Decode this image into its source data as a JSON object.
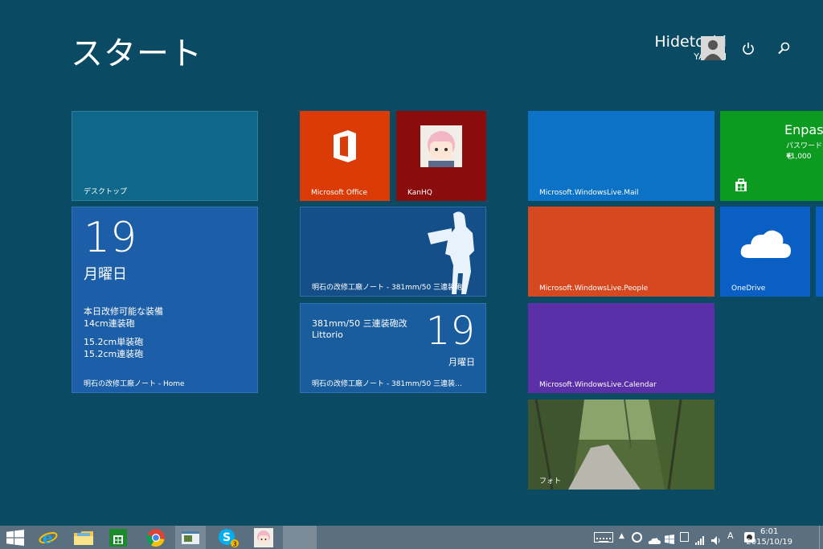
{
  "screen": {
    "title": "スタート"
  },
  "user": {
    "name": "Hidetoshi",
    "subname": "YANAGI"
  },
  "tiles": {
    "desktop": {
      "label": "デスクトップ"
    },
    "calendar_home": {
      "day": "19",
      "weekday": "月曜日",
      "line1": "本日改修可能な装備",
      "line2": "14cm連装砲",
      "line3": "15.2cm単装砲",
      "line4": "15.2cm連装砲",
      "label": "明石の改修工廠ノート - Home"
    },
    "office": {
      "label": "Microsoft Office"
    },
    "kanhq": {
      "label": "KanHQ"
    },
    "blog_a": {
      "label": "明石の改修工廠ノート - 381mm/50 三連装砲"
    },
    "blog_b": {
      "line1": "381mm/50 三連装砲改",
      "line2": "Littorio",
      "day": "19",
      "weekday": "月曜日",
      "label": "明石の改修工廠ノート - 381mm/50 三連装…"
    },
    "mail": {
      "label": "Microsoft.WindowsLive.Mail"
    },
    "people": {
      "label": "Microsoft.WindowsLive.People"
    },
    "calendar": {
      "label": "Microsoft.WindowsLive.Calendar"
    },
    "photos": {
      "label": "フォト"
    },
    "store": {
      "app": "Enpas",
      "subtitle": "パスワードを",
      "price": "¥1,000"
    },
    "onedrive": {
      "label": "OneDrive"
    }
  },
  "taskbar": {
    "apps": [
      "windows-logo",
      "internet-explorer",
      "file-explorer",
      "store",
      "chrome",
      "desktop-app",
      "skype",
      "kanhq"
    ],
    "skype_badge": "3",
    "ime": "A",
    "time": "6:01",
    "date": "2015/10/19"
  },
  "colors": {
    "background": "#0b4a63",
    "office": "#db3b06",
    "kanhq": "#8a0c0c",
    "mail": "#0b72c6",
    "people": "#d54820",
    "calendar": "#5a2fa7",
    "store": "#0c9a20",
    "onedrive": "#0a5fc4"
  }
}
